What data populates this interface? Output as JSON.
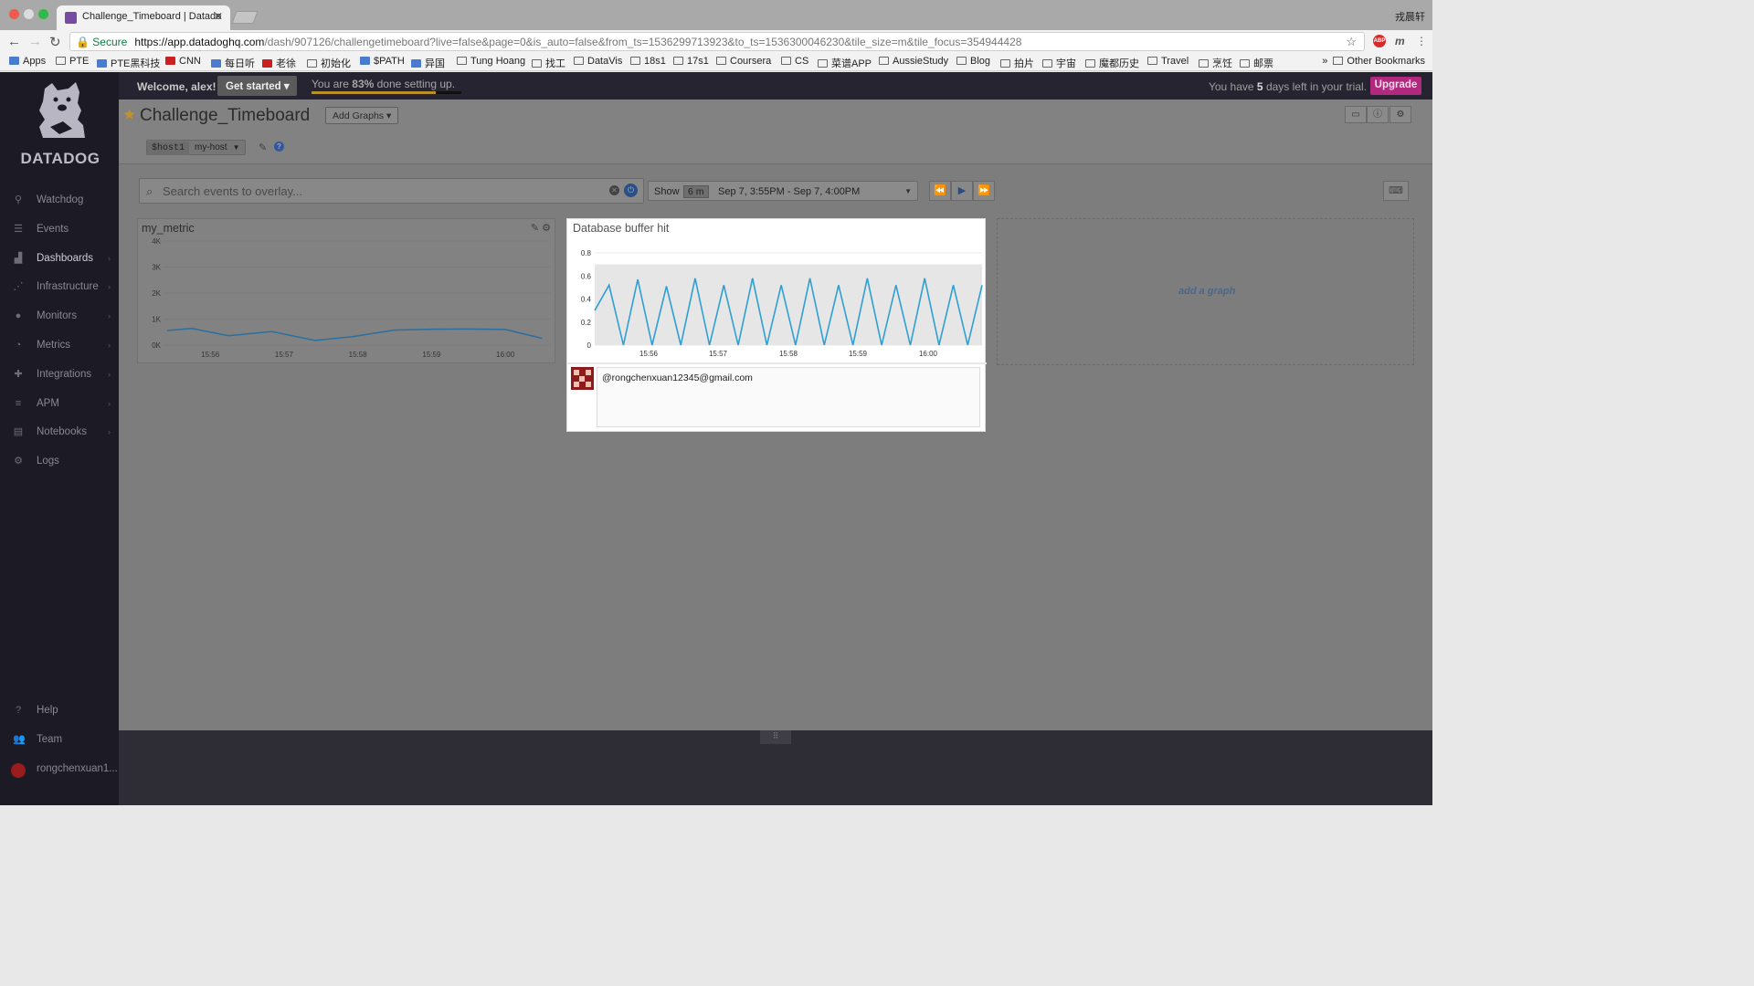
{
  "browser": {
    "tab_title": "Challenge_Timeboard | Datado",
    "user": "戎晨轩",
    "secure_label": "Secure",
    "url_host": "https://app.datadoghq.com",
    "url_path": "/dash/907126/challengetimeboard?live=false&page=0&is_auto=false&from_ts=1536299713923&to_ts=1536300046230&tile_size=m&tile_focus=354944428",
    "ext_m": "m",
    "abp": "ABP",
    "bookmarks": [
      "Apps",
      "PTE",
      "PTE黑科技",
      "CNN",
      "每日听",
      "老徐",
      "初始化",
      "$PATH",
      "异国",
      "Tung Hoang",
      "找工",
      "DataVis",
      "18s1",
      "17s1",
      "Coursera",
      "CS",
      "菜谱APP",
      "AussieStudy",
      "Blog",
      "拍片",
      "宇宙",
      "魔都历史",
      "Travel",
      "烹饪",
      "邮票"
    ],
    "bookmark_more": "»",
    "bookmark_other": "Other Bookmarks"
  },
  "sidebar": {
    "logo_text": "DATADOG",
    "items": [
      {
        "label": "Watchdog",
        "icon": "binoculars-icon"
      },
      {
        "label": "Events",
        "icon": "list-icon"
      },
      {
        "label": "Dashboards",
        "icon": "chart-icon"
      },
      {
        "label": "Infrastructure",
        "icon": "network-icon"
      },
      {
        "label": "Monitors",
        "icon": "alert-icon"
      },
      {
        "label": "Metrics",
        "icon": "gauge-icon"
      },
      {
        "label": "Integrations",
        "icon": "puzzle-icon"
      },
      {
        "label": "APM",
        "icon": "apm-icon"
      },
      {
        "label": "Notebooks",
        "icon": "notebook-icon"
      },
      {
        "label": "Logs",
        "icon": "logs-icon"
      }
    ],
    "bottom": [
      {
        "label": "Help",
        "icon": "help-icon"
      },
      {
        "label": "Team",
        "icon": "team-icon"
      },
      {
        "label": "rongchenxuan1...",
        "icon": "user-avatar"
      }
    ]
  },
  "topbar": {
    "welcome": "Welcome, alex!",
    "get_started": "Get started ▾",
    "progress_prefix": "You are ",
    "progress_value": "83%",
    "progress_suffix": " done setting up.",
    "progress_fraction": 0.83,
    "trial_prefix": "You have ",
    "trial_days": "5",
    "trial_suffix": " days left in your trial.",
    "upgrade": "Upgrade",
    "accent_color": "#b3287f"
  },
  "dashboard": {
    "title": "Challenge_Timeboard",
    "add_graphs": "Add Graphs ▾",
    "template_var_name": "$host1",
    "template_var_value": "my-host",
    "search_placeholder": "Search events to overlay...",
    "show_label": "Show",
    "range_badge": "6 m",
    "range_text": "Sep 7, 3:55PM - Sep 7, 4:00PM",
    "add_a_graph": "add a graph"
  },
  "widgets": {
    "my_metric": {
      "title": "my_metric"
    },
    "buffer": {
      "title": "Database buffer hit",
      "note": "@rongchenxuan12345@gmail.com"
    }
  },
  "chart_data": [
    {
      "type": "line",
      "x": [
        "15:55:25",
        "15:55:45",
        "15:56:15",
        "15:56:50",
        "15:57:25",
        "15:57:55",
        "15:58:30",
        "15:59:00",
        "15:59:30",
        "16:00:00",
        "16:00:30"
      ],
      "y": [
        560,
        640,
        360,
        520,
        180,
        320,
        580,
        610,
        620,
        600,
        260
      ],
      "xticks": [
        "15:56",
        "15:57",
        "15:58",
        "15:59",
        "16:00"
      ],
      "yticks": [
        "0K",
        "1K",
        "2K",
        "3K",
        "4K"
      ],
      "ylim": [
        0,
        4000
      ],
      "color": "#2a6f9e"
    },
    {
      "type": "line",
      "series_color": "#2d9fd3",
      "band_color": "#e6e6e6",
      "y": [
        0.3,
        0.52,
        0.0,
        0.57,
        0.0,
        0.51,
        0.0,
        0.58,
        0.0,
        0.52,
        0.0,
        0.58,
        0.0,
        0.52,
        0.0,
        0.58,
        0.0,
        0.52,
        0.0,
        0.58,
        0.0,
        0.52,
        0.0,
        0.58,
        0.0,
        0.52,
        0.0,
        0.52
      ],
      "band": [
        0.68,
        0.7
      ],
      "xticks": [
        "15:56",
        "15:57",
        "15:58",
        "15:59",
        "16:00"
      ],
      "yticks": [
        "0",
        "0.2",
        "0.4",
        "0.6",
        "0.8"
      ],
      "ylim": [
        0,
        0.8
      ]
    }
  ]
}
